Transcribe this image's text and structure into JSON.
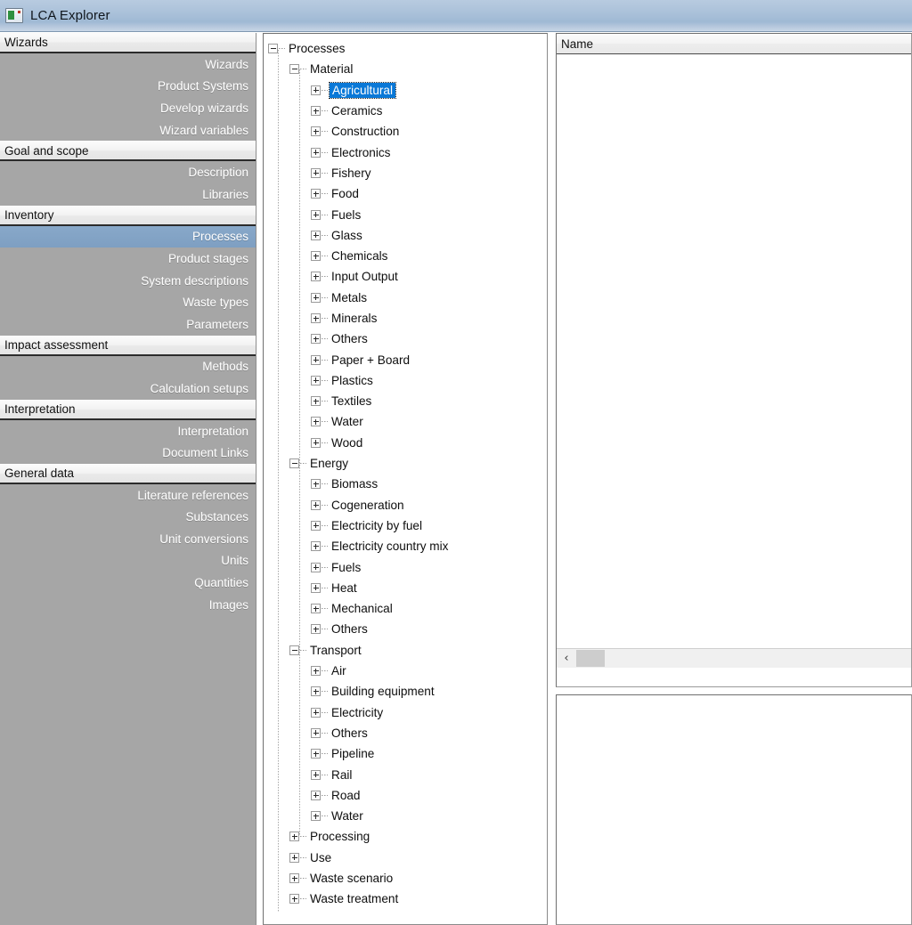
{
  "window": {
    "title": "LCA Explorer",
    "icon": "app-window-icon"
  },
  "sidebar": {
    "sections": [
      {
        "header": "Wizards",
        "items": [
          {
            "label": "Wizards",
            "selected": false
          },
          {
            "label": "Product Systems",
            "selected": false
          },
          {
            "label": "Develop wizards",
            "selected": false
          },
          {
            "label": "Wizard variables",
            "selected": false
          }
        ]
      },
      {
        "header": "Goal and scope",
        "items": [
          {
            "label": "Description",
            "selected": false
          },
          {
            "label": "Libraries",
            "selected": false
          }
        ]
      },
      {
        "header": "Inventory",
        "items": [
          {
            "label": "Processes",
            "selected": true
          },
          {
            "label": "Product stages",
            "selected": false
          },
          {
            "label": "System descriptions",
            "selected": false
          },
          {
            "label": "Waste types",
            "selected": false
          },
          {
            "label": "Parameters",
            "selected": false
          }
        ]
      },
      {
        "header": "Impact assessment",
        "items": [
          {
            "label": "Methods",
            "selected": false
          },
          {
            "label": "Calculation setups",
            "selected": false
          }
        ]
      },
      {
        "header": "Interpretation",
        "items": [
          {
            "label": "Interpretation",
            "selected": false
          },
          {
            "label": "Document Links",
            "selected": false
          }
        ]
      },
      {
        "header": "General data",
        "items": [
          {
            "label": "Literature references",
            "selected": false
          },
          {
            "label": "Substances",
            "selected": false
          },
          {
            "label": "Unit conversions",
            "selected": false
          },
          {
            "label": "Units",
            "selected": false
          },
          {
            "label": "Quantities",
            "selected": false
          },
          {
            "label": "Images",
            "selected": false
          }
        ]
      }
    ],
    "selected_color": "#7e9fc2",
    "background_color": "#a6a6a6"
  },
  "tree": {
    "selection_color": "#0a78d7",
    "nodes": [
      {
        "label": "Processes",
        "depth": 0,
        "state": "expanded",
        "selected": false
      },
      {
        "label": "Material",
        "depth": 1,
        "state": "expanded",
        "selected": false
      },
      {
        "label": "Agricultural",
        "depth": 2,
        "state": "collapsed",
        "selected": true
      },
      {
        "label": "Ceramics",
        "depth": 2,
        "state": "collapsed",
        "selected": false
      },
      {
        "label": "Construction",
        "depth": 2,
        "state": "collapsed",
        "selected": false
      },
      {
        "label": "Electronics",
        "depth": 2,
        "state": "collapsed",
        "selected": false
      },
      {
        "label": "Fishery",
        "depth": 2,
        "state": "collapsed",
        "selected": false
      },
      {
        "label": "Food",
        "depth": 2,
        "state": "collapsed",
        "selected": false
      },
      {
        "label": "Fuels",
        "depth": 2,
        "state": "collapsed",
        "selected": false
      },
      {
        "label": "Glass",
        "depth": 2,
        "state": "collapsed",
        "selected": false
      },
      {
        "label": "Chemicals",
        "depth": 2,
        "state": "collapsed",
        "selected": false
      },
      {
        "label": "Input Output",
        "depth": 2,
        "state": "collapsed",
        "selected": false
      },
      {
        "label": "Metals",
        "depth": 2,
        "state": "collapsed",
        "selected": false
      },
      {
        "label": "Minerals",
        "depth": 2,
        "state": "collapsed",
        "selected": false
      },
      {
        "label": "Others",
        "depth": 2,
        "state": "collapsed",
        "selected": false
      },
      {
        "label": "Paper + Board",
        "depth": 2,
        "state": "collapsed",
        "selected": false
      },
      {
        "label": "Plastics",
        "depth": 2,
        "state": "collapsed",
        "selected": false
      },
      {
        "label": "Textiles",
        "depth": 2,
        "state": "collapsed",
        "selected": false
      },
      {
        "label": "Water",
        "depth": 2,
        "state": "collapsed",
        "selected": false
      },
      {
        "label": "Wood",
        "depth": 2,
        "state": "collapsed",
        "selected": false
      },
      {
        "label": "Energy",
        "depth": 1,
        "state": "expanded",
        "selected": false
      },
      {
        "label": "Biomass",
        "depth": 2,
        "state": "collapsed",
        "selected": false
      },
      {
        "label": "Cogeneration",
        "depth": 2,
        "state": "collapsed",
        "selected": false
      },
      {
        "label": "Electricity by fuel",
        "depth": 2,
        "state": "collapsed",
        "selected": false
      },
      {
        "label": "Electricity country mix",
        "depth": 2,
        "state": "collapsed",
        "selected": false
      },
      {
        "label": "Fuels",
        "depth": 2,
        "state": "collapsed",
        "selected": false
      },
      {
        "label": "Heat",
        "depth": 2,
        "state": "collapsed",
        "selected": false
      },
      {
        "label": "Mechanical",
        "depth": 2,
        "state": "collapsed",
        "selected": false
      },
      {
        "label": "Others",
        "depth": 2,
        "state": "collapsed",
        "selected": false
      },
      {
        "label": "Transport",
        "depth": 1,
        "state": "expanded",
        "selected": false
      },
      {
        "label": "Air",
        "depth": 2,
        "state": "collapsed",
        "selected": false
      },
      {
        "label": "Building equipment",
        "depth": 2,
        "state": "collapsed",
        "selected": false
      },
      {
        "label": "Electricity",
        "depth": 2,
        "state": "collapsed",
        "selected": false
      },
      {
        "label": "Others",
        "depth": 2,
        "state": "collapsed",
        "selected": false
      },
      {
        "label": "Pipeline",
        "depth": 2,
        "state": "collapsed",
        "selected": false
      },
      {
        "label": "Rail",
        "depth": 2,
        "state": "collapsed",
        "selected": false
      },
      {
        "label": "Road",
        "depth": 2,
        "state": "collapsed",
        "selected": false
      },
      {
        "label": "Water",
        "depth": 2,
        "state": "collapsed",
        "selected": false
      },
      {
        "label": "Processing",
        "depth": 1,
        "state": "collapsed",
        "selected": false
      },
      {
        "label": "Use",
        "depth": 1,
        "state": "collapsed",
        "selected": false
      },
      {
        "label": "Waste scenario",
        "depth": 1,
        "state": "collapsed",
        "selected": false
      },
      {
        "label": "Waste treatment",
        "depth": 1,
        "state": "collapsed",
        "selected": false
      }
    ]
  },
  "list_panel": {
    "columns": [
      "Name"
    ],
    "rows": [],
    "hscroll": {
      "left_arrow": "‹",
      "thumb_visible": true
    }
  },
  "detail_panel": {
    "content": ""
  }
}
